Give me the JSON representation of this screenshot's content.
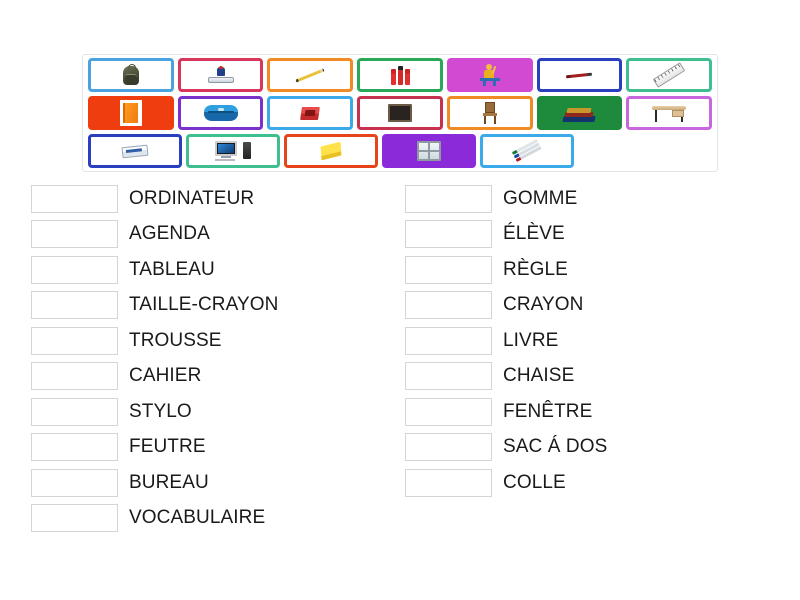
{
  "activity": {
    "type": "match-up-drag-and-drop",
    "tile_panel": {
      "rows": [
        [
          {
            "id": "sac-a-dos",
            "icon": "backpack-icon",
            "border_color": "#4aa3e0",
            "fill": "#ffffff"
          },
          {
            "id": "eleve-ouvrage",
            "icon": "open-book-student-icon",
            "border_color": "#d8365a",
            "fill": "#ffffff"
          },
          {
            "id": "crayon",
            "icon": "pencil-icon",
            "border_color": "#f08a22",
            "fill": "#ffffff"
          },
          {
            "id": "colle",
            "icon": "glue-sticks-icon",
            "border_color": "#2aa85a",
            "fill": "#ffffff"
          },
          {
            "id": "eleve",
            "icon": "student-at-desk-icon",
            "border_color": "#d24ad2",
            "fill": "#d24ad2"
          },
          {
            "id": "stylo",
            "icon": "red-pen-icon",
            "border_color": "#2a3fc0",
            "fill": "#ffffff"
          },
          {
            "id": "regle",
            "icon": "ruler-icon",
            "border_color": "#3fbf8f",
            "fill": "#ffffff"
          }
        ],
        [
          {
            "id": "agenda",
            "icon": "orange-notebook-icon",
            "border_color": "#ef3d10",
            "fill": "#ef3d10"
          },
          {
            "id": "trousse",
            "icon": "pencil-case-icon",
            "border_color": "#7a32cc",
            "fill": "#ffffff"
          },
          {
            "id": "taille-crayon",
            "icon": "pencil-sharpener-icon",
            "border_color": "#3aaae8",
            "fill": "#ffffff"
          },
          {
            "id": "tableau",
            "icon": "blackboard-icon",
            "border_color": "#c83050",
            "fill": "#ffffff"
          },
          {
            "id": "chaise",
            "icon": "chair-icon",
            "border_color": "#f08a22",
            "fill": "#ffffff"
          },
          {
            "id": "livre",
            "icon": "stacked-books-icon",
            "border_color": "#1e8a3c",
            "fill": "#1e8a3c"
          },
          {
            "id": "bureau",
            "icon": "desk-icon",
            "border_color": "#c766dd",
            "fill": "#ffffff"
          }
        ],
        [
          {
            "id": "gomme",
            "icon": "eraser-icon",
            "border_color": "#2a3fc0",
            "fill": "#ffffff"
          },
          {
            "id": "ordinateur",
            "icon": "desktop-computer-icon",
            "border_color": "#3fbf8f",
            "fill": "#ffffff"
          },
          {
            "id": "cahier",
            "icon": "yellow-notebook-icon",
            "border_color": "#e8441a",
            "fill": "#ffffff"
          },
          {
            "id": "fenetre",
            "icon": "window-icon",
            "border_color": "#8a2ad8",
            "fill": "#8a2ad8"
          },
          {
            "id": "feutre",
            "icon": "felt-tip-markers-icon",
            "border_color": "#3aaae8",
            "fill": "#ffffff"
          }
        ]
      ]
    },
    "word_list": {
      "left_column": [
        {
          "label": "ORDINATEUR",
          "answer_value": ""
        },
        {
          "label": "AGENDA",
          "answer_value": ""
        },
        {
          "label": "TABLEAU",
          "answer_value": ""
        },
        {
          "label": "TAILLE-CRAYON",
          "answer_value": ""
        },
        {
          "label": "TROUSSE",
          "answer_value": ""
        },
        {
          "label": "CAHIER",
          "answer_value": ""
        },
        {
          "label": "STYLO",
          "answer_value": ""
        },
        {
          "label": "FEUTRE",
          "answer_value": ""
        },
        {
          "label": "BUREAU",
          "answer_value": ""
        },
        {
          "label": "VOCABULAIRE",
          "answer_value": ""
        }
      ],
      "right_column": [
        {
          "label": "GOMME",
          "answer_value": ""
        },
        {
          "label": "ÉLÈVE",
          "answer_value": ""
        },
        {
          "label": "RÈGLE",
          "answer_value": ""
        },
        {
          "label": "CRAYON",
          "answer_value": ""
        },
        {
          "label": "LIVRE",
          "answer_value": ""
        },
        {
          "label": "CHAISE",
          "answer_value": ""
        },
        {
          "label": "FENÊTRE",
          "answer_value": ""
        },
        {
          "label": "SAC Á DOS",
          "answer_value": ""
        },
        {
          "label": "COLLE",
          "answer_value": ""
        }
      ]
    },
    "colors": {
      "page_background": "#ffffff",
      "panel_border": "#e3e3e3",
      "drop_box_border": "#d5d5d5",
      "word_text": "#1a1a1a"
    }
  }
}
